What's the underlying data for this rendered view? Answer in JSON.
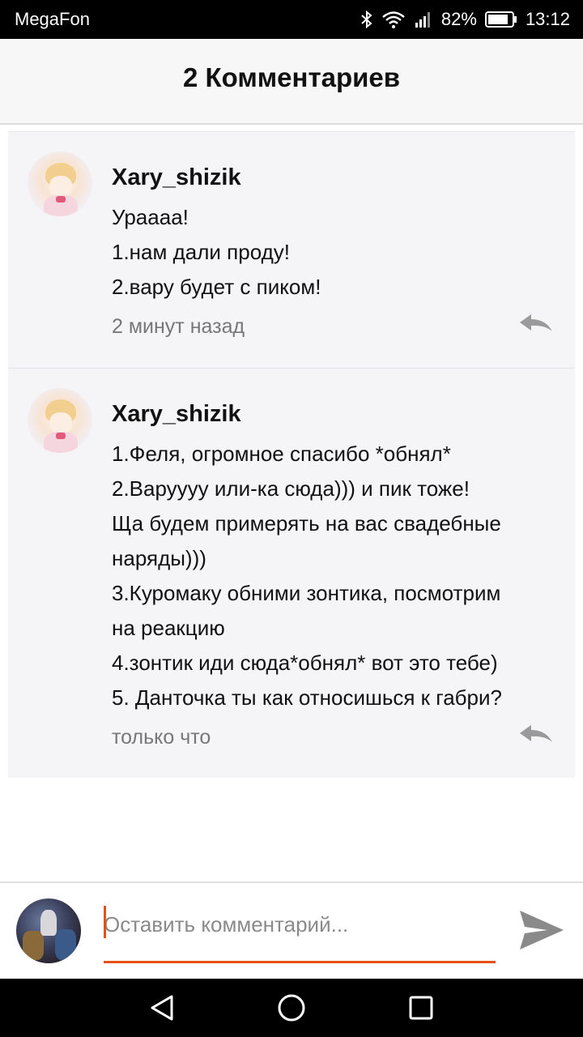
{
  "status_bar": {
    "carrier": "MegaFon",
    "battery_percent": "82%",
    "time": "13:12"
  },
  "header": {
    "title": "2 Комментариев"
  },
  "comments": [
    {
      "author": "Xary_shizik",
      "lines": [
        "Ураааа!",
        "1.нам дали проду!",
        "2.вару будет с пиком!"
      ],
      "time": "2 минут назад"
    },
    {
      "author": "Xary_shizik",
      "lines": [
        "1.Феля, огромное спасибо *обнял*",
        "2.Варуууу или-ка сюда))) и пик тоже!",
        "Ща будем примерять на вас свадебные",
        "наряды)))",
        "3.Куромаку обними зонтика, посмотрим",
        "на реакцию",
        "4.зонтик иди сюда*обнял* вот  это тебе)",
        "5. Данточка ты как относишься к габри?"
      ],
      "time": "только что"
    }
  ],
  "input": {
    "placeholder": "Оставить комментарий...",
    "value": ""
  },
  "colors": {
    "accent": "#e8501a",
    "comment_bg": "#f5f4f7",
    "header_bg": "#f7f7f7"
  },
  "icons": {
    "reply": "reply-arrow-icon",
    "send": "send-icon",
    "back": "nav-back-icon",
    "home": "nav-home-icon",
    "recent": "nav-recent-icon"
  }
}
